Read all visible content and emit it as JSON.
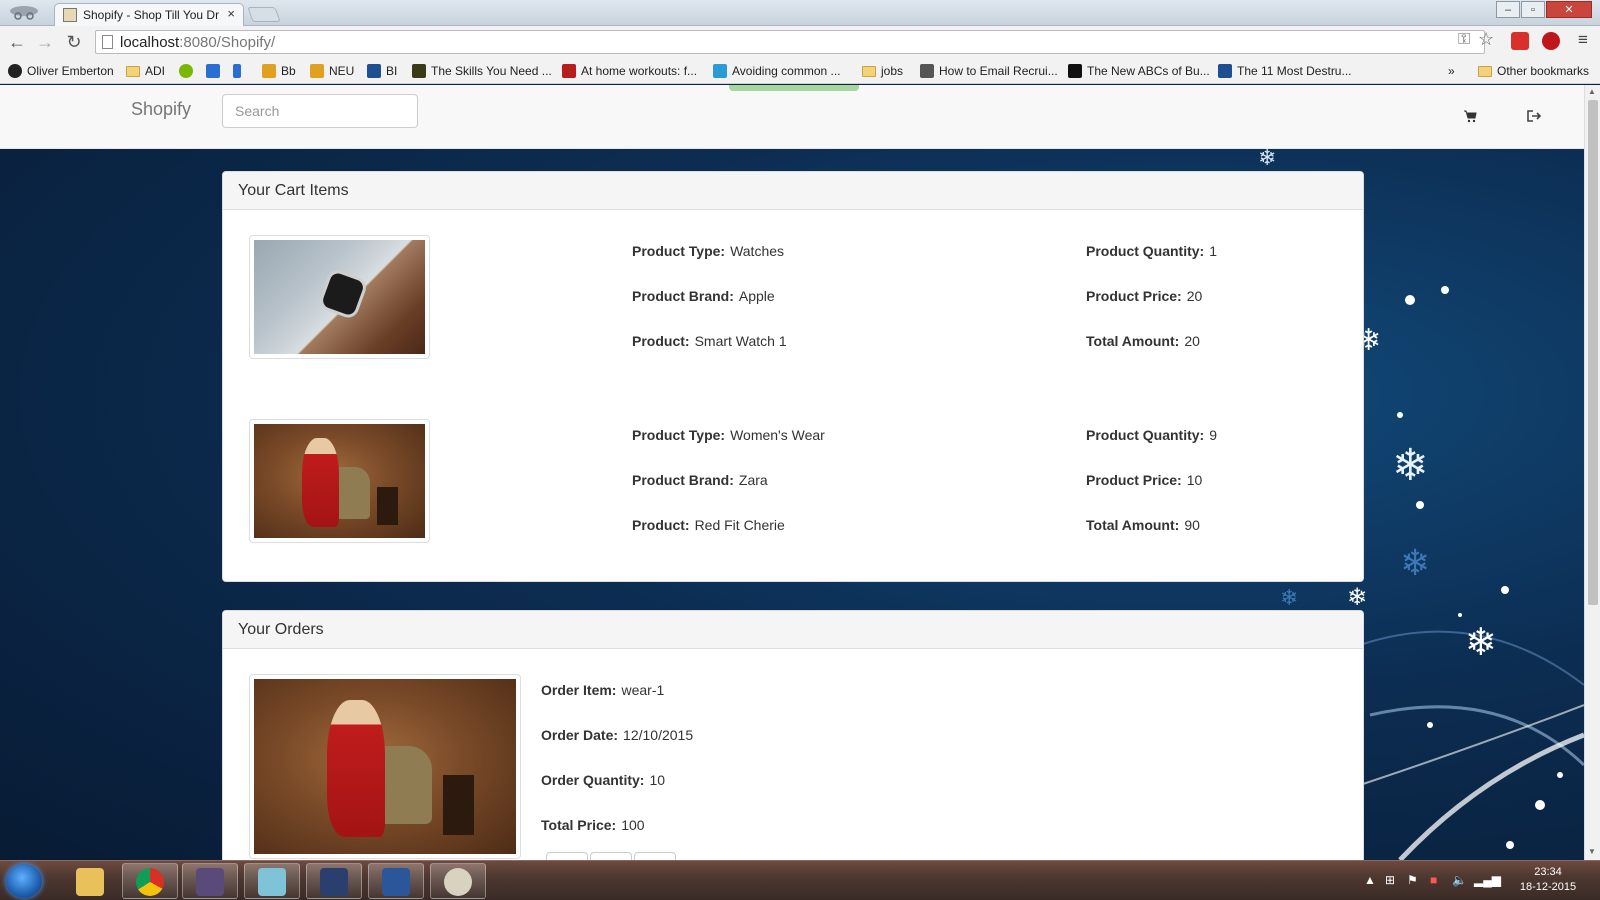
{
  "browser": {
    "tab_title": "Shopify - Shop Till You Dr",
    "tab_close": "×",
    "url_host": "localhost",
    "url_path": ":8080/Shopify/",
    "window_controls": {
      "minimize": "–",
      "maximize": "▫",
      "close": "✕"
    },
    "bookmarks": [
      {
        "label": "Oliver Emberton",
        "icon_color": "#222222"
      },
      {
        "label": "ADI",
        "icon": "folder"
      },
      {
        "label": "",
        "icon_color": "#7ab800"
      },
      {
        "label": "",
        "icon_color": "#2a6ed1"
      },
      {
        "label": "",
        "icon_color": "#2a6ed1"
      },
      {
        "label": "Bb",
        "icon_color": "#e0a020"
      },
      {
        "label": "NEU",
        "icon_color": "#e0a020"
      },
      {
        "label": "BI",
        "icon_color": "#1d4f91"
      },
      {
        "label": "The Skills You Need ...",
        "icon_color": "#3a3a1a"
      },
      {
        "label": "At home workouts: f...",
        "icon_color": "#b81d1d"
      },
      {
        "label": "Avoiding common ...",
        "icon_color": "#2b9bd6"
      },
      {
        "label": "jobs",
        "icon": "folder"
      },
      {
        "label": "How to Email Recrui...",
        "icon_color": "#555555"
      },
      {
        "label": "The New ABCs of Bu...",
        "icon_color": "#111111"
      },
      {
        "label": "The 11 Most Destru...",
        "icon_color": "#1d4f91"
      }
    ],
    "bookmarks_overflow": "»",
    "other_bookmarks": "Other bookmarks"
  },
  "site": {
    "brand": "Shopify",
    "search_placeholder": "Search"
  },
  "cart": {
    "heading": "Your Cart Items",
    "labels": {
      "type": "Product Type:",
      "brand": "Product Brand:",
      "product": "Product:",
      "quantity": "Product Quantity:",
      "price": "Product Price:",
      "total": "Total Amount:"
    },
    "items": [
      {
        "type": "Watches",
        "brand": "Apple",
        "product": "Smart Watch 1",
        "quantity": "1",
        "price": "20",
        "total": "20"
      },
      {
        "type": "Women's Wear",
        "brand": "Zara",
        "product": "Red Fit Cherie",
        "quantity": "9",
        "price": "10",
        "total": "90"
      }
    ]
  },
  "orders": {
    "heading": "Your Orders",
    "labels": {
      "item": "Order Item:",
      "date": "Order Date:",
      "quantity": "Order Quantity:",
      "total": "Total Price:"
    },
    "items": [
      {
        "item": "wear-1",
        "date": "12/10/2015",
        "quantity": "10",
        "total": "100"
      }
    ]
  },
  "taskbar": {
    "time": "23:34",
    "date": "18-12-2015"
  }
}
